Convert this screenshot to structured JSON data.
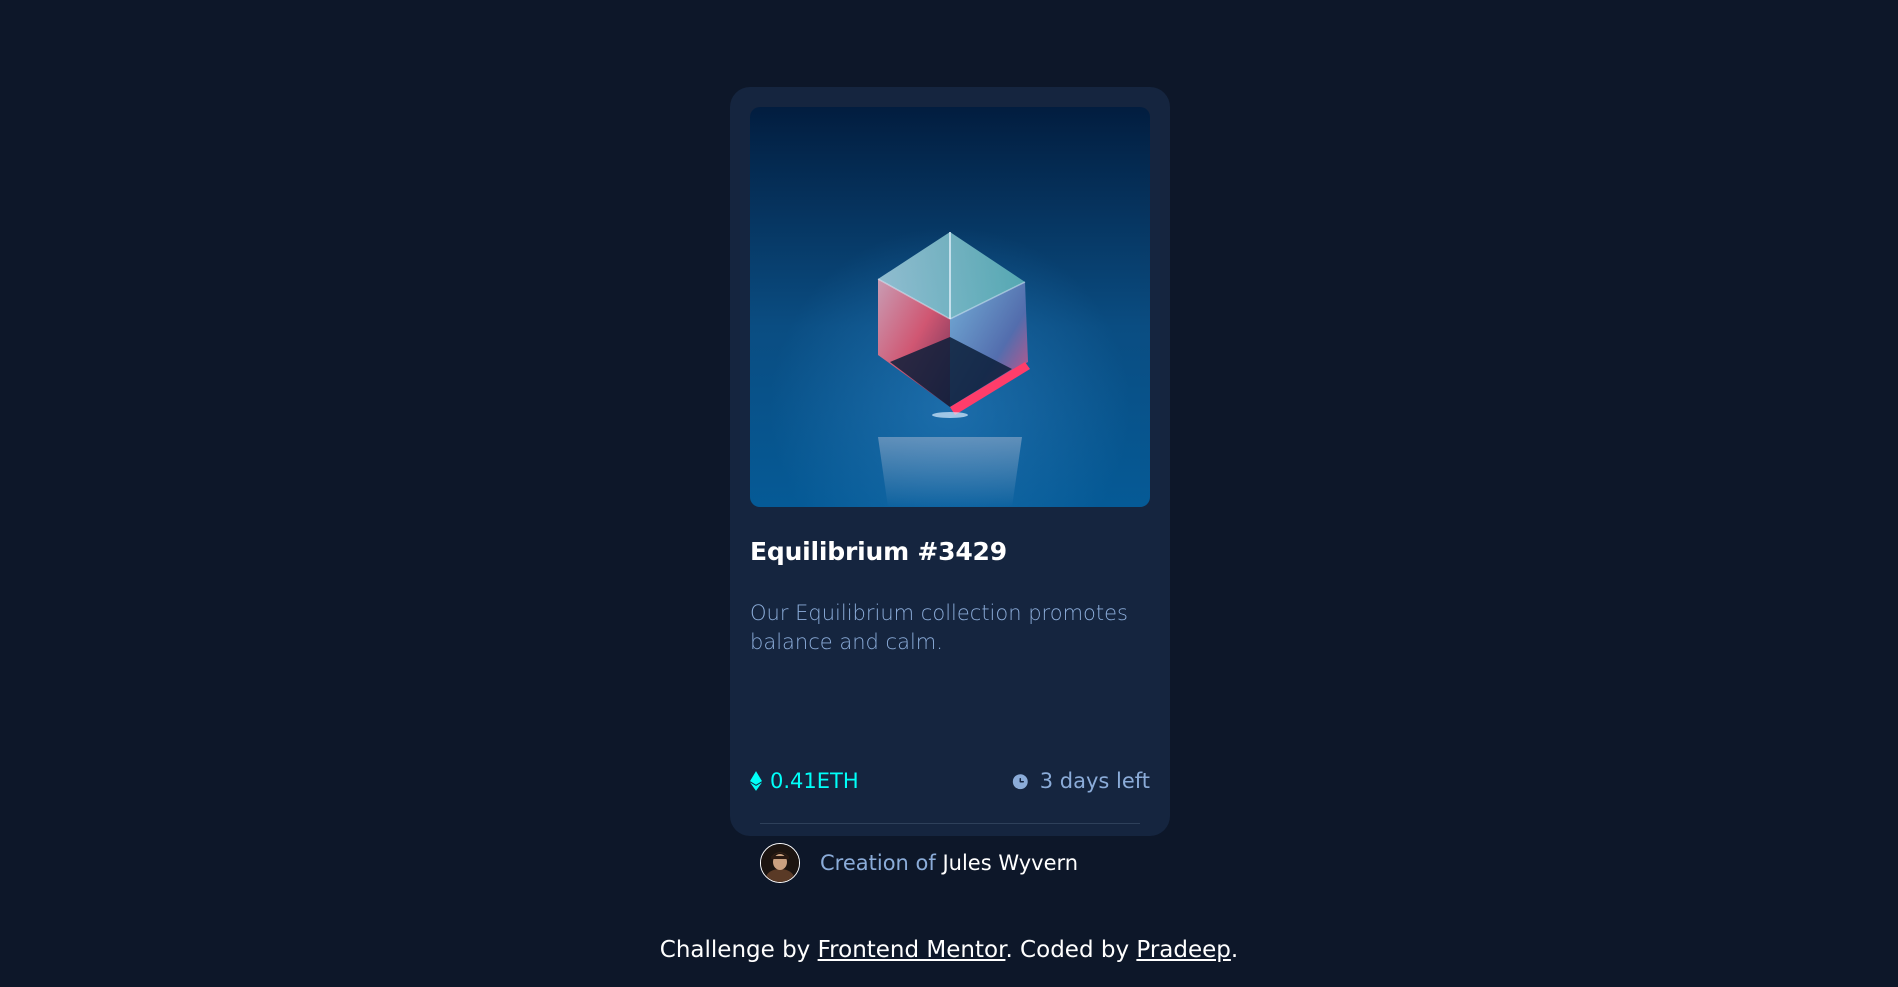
{
  "card": {
    "image_alt": "Equilibrium",
    "title": "Equilibrium #3429",
    "description": "Our Equilibrium collection promotes balance and calm.",
    "price": "0.41ETH",
    "time_left": "3 days left",
    "creator_prefix": "Creation of",
    "creator_name": "Jules Wyvern",
    "icons": {
      "price": "ethereum-icon",
      "time": "clock-icon"
    }
  },
  "footer": {
    "prefix": "Challenge by",
    "link1": "Frontend Mentor",
    "middle": ". Coded by",
    "link2": "Pradeep",
    "suffix": "."
  },
  "colors": {
    "background": "#0d1729",
    "card": "#15253f",
    "accent_cyan": "#00fff8",
    "soft_blue": "#8bacd9",
    "white": "#ffffff"
  }
}
